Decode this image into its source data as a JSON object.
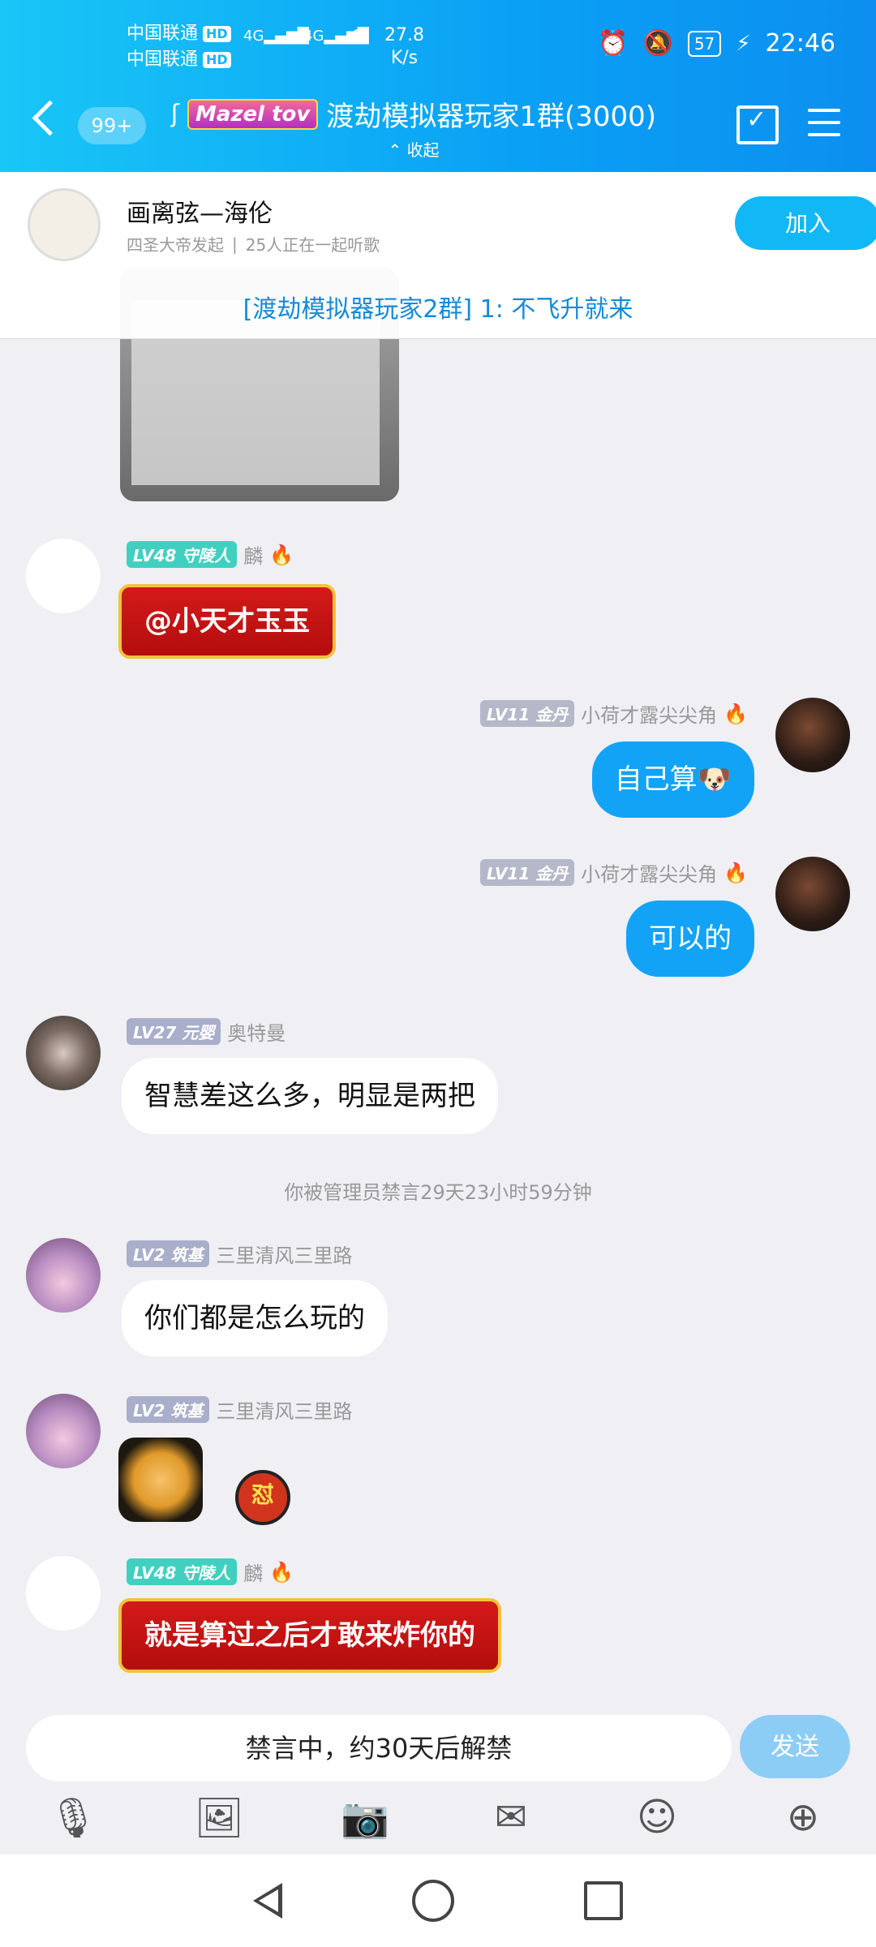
{
  "status": {
    "carrier1": "中国联通",
    "carrier2": "中国联通",
    "hd": "HD",
    "net": "4G",
    "speed_value": "27.8",
    "speed_unit": "K/s",
    "battery": "57",
    "time": "22:46"
  },
  "header": {
    "unread": "99+",
    "badge": "Mazel tov",
    "title": "渡劫模拟器玩家1群(3000)",
    "collapse": "收起"
  },
  "banner": {
    "song": "画离弦—海伦",
    "initiator": "四圣大帝发起",
    "listeners": "25人正在一起听歌",
    "join": "加入",
    "notice": "[渡劫模拟器玩家2群] 1: 不飞升就来"
  },
  "messages": {
    "m1": {
      "level": "LV48 守陵人",
      "name": "麟",
      "text": "@小天才玉玉"
    },
    "m2": {
      "level": "LV11 金丹",
      "name": "小荷才露尖尖角",
      "text": "自己算🐶"
    },
    "m3": {
      "level": "LV11 金丹",
      "name": "小荷才露尖尖角",
      "text": "可以的"
    },
    "m4": {
      "level": "LV27 元婴",
      "name": "奥特曼",
      "text": "智慧差这么多，明显是两把"
    },
    "system": "你被管理员禁言29天23小时59分钟",
    "m5": {
      "level": "LV2 筑基",
      "name": "三里清风三里路",
      "text": "你们都是怎么玩的"
    },
    "m6": {
      "level": "LV2 筑基",
      "name": "三里清风三里路",
      "badge": "怼"
    },
    "m7": {
      "level": "LV48 守陵人",
      "name": "麟",
      "text": "就是算过之后才敢来炸你的"
    }
  },
  "input": {
    "placeholder": "禁言中，约30天后解禁",
    "send": "发送"
  }
}
